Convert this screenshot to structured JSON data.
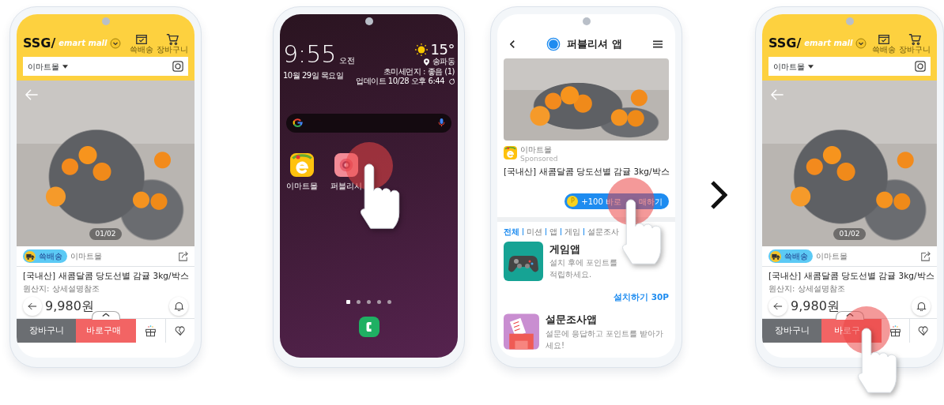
{
  "phones": [
    {
      "kind": "shop",
      "logo": "SSG/",
      "logo_brand": "emart mall",
      "header_icons": [
        {
          "kind": "delivery",
          "label": "쓱배송"
        },
        {
          "kind": "cart",
          "label": "장바구니"
        }
      ],
      "mall_select": "이마트몰",
      "image_counter": "01/02",
      "delivery_badge": "쓱배송",
      "seller": "이마트몰",
      "title": "[국내산] 새콤달콤 당도선별 감귤 3kg/박스",
      "origin": "원산지: 상세설명참조",
      "price": "9,980원",
      "cart_button": "장바구니",
      "buy_button": "바로구매",
      "tap": false
    },
    {
      "kind": "home",
      "time": "9:55",
      "ampm": "오전",
      "date": "10월 29일 목요일",
      "temperature": "15°",
      "location": "송파동",
      "air": "초미세먼지 : 좋음 (1)",
      "updated": "업데이트 10/28 오후 6:44",
      "apps": [
        {
          "kind": "emart",
          "label": "이마트몰"
        },
        {
          "kind": "publisher",
          "label": "퍼블리시"
        }
      ],
      "pages": [
        {
          "selected": true
        },
        {
          "selected": false
        },
        {
          "selected": false
        },
        {
          "selected": false
        },
        {
          "selected": false
        }
      ],
      "tap": true
    },
    {
      "kind": "publisher",
      "title": "퍼블리셔 앱",
      "ad": {
        "advertiser": "이마트몰",
        "sponsored": "Sponsored",
        "title": "[국내산] 새콤달콤 당도선별 감귤 3kg/박스",
        "coin": "P",
        "button": "+100 바로",
        "button_rest": "매하기"
      },
      "tabs": [
        {
          "label": "전체",
          "selected": true
        },
        {
          "label": "미션",
          "selected": false
        },
        {
          "label": "앱",
          "selected": false
        },
        {
          "label": "게임",
          "selected": false
        },
        {
          "label": "설문조사",
          "selected": false
        }
      ],
      "offers": [
        {
          "kind": "game",
          "title": "게임앱",
          "description": "설치 후에 포인트를 적립하세요.",
          "action": "설치하기 30P"
        },
        {
          "kind": "survey",
          "title": "설문조사앱",
          "description": "설문에 응답하고 포인트를 받아가세요!"
        }
      ],
      "tap": true
    },
    {
      "kind": "shop",
      "logo": "SSG/",
      "logo_brand": "emart mall",
      "header_icons": [
        {
          "kind": "delivery",
          "label": "쓱배송"
        },
        {
          "kind": "cart",
          "label": "장바구니"
        }
      ],
      "mall_select": "이마트몰",
      "image_counter": "01/02",
      "delivery_badge": "쓱배송",
      "seller": "이마트몰",
      "title": "[국내산] 새콤달콤 당도선별 감귤 3kg/박스",
      "origin": "원산지: 상세설명참조",
      "price": "9,980원",
      "cart_button": "장바구니",
      "buy_button": "바로구",
      "tap": true
    }
  ]
}
